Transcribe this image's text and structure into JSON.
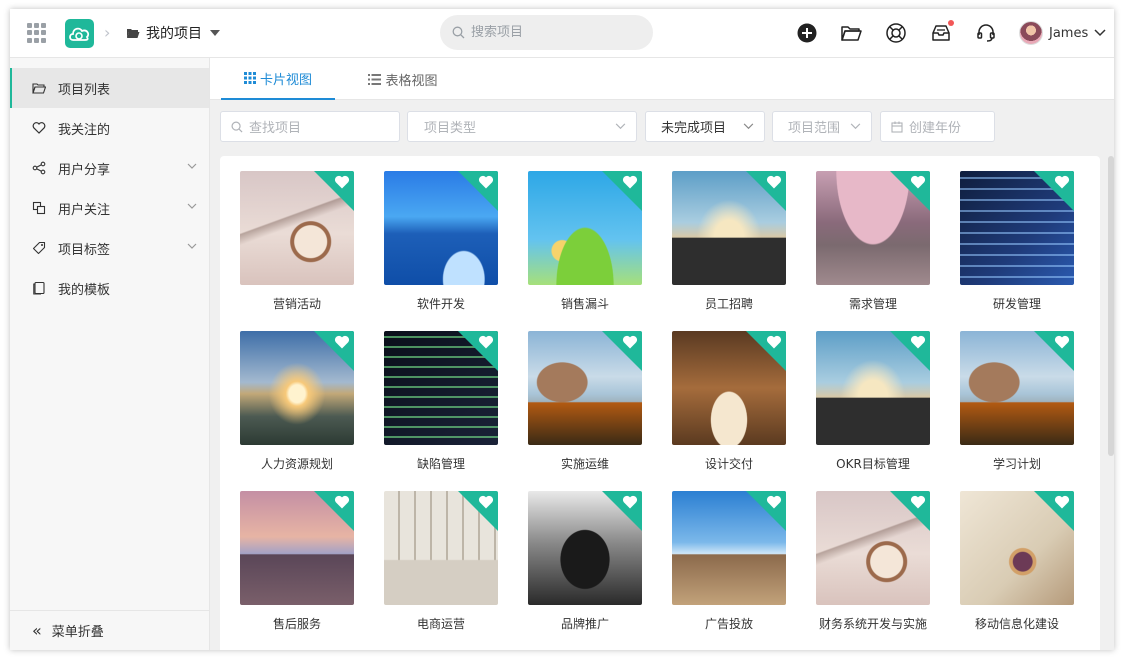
{
  "topbar": {
    "project_menu_label": "我的项目",
    "search_placeholder": "搜索项目",
    "user_name": "James"
  },
  "sidebar": {
    "items": [
      {
        "label": "项目列表",
        "icon": "folder-open-icon",
        "active": true,
        "expandable": false
      },
      {
        "label": "我关注的",
        "icon": "heart-outline-icon",
        "active": false,
        "expandable": false
      },
      {
        "label": "用户分享",
        "icon": "share-icon",
        "active": false,
        "expandable": true
      },
      {
        "label": "用户关注",
        "icon": "copy-icon",
        "active": false,
        "expandable": true
      },
      {
        "label": "项目标签",
        "icon": "tag-icon",
        "active": false,
        "expandable": true
      },
      {
        "label": "我的模板",
        "icon": "template-icon",
        "active": false,
        "expandable": false
      }
    ],
    "collapse_label": "菜单折叠"
  },
  "tabs": [
    {
      "label": "卡片视图",
      "icon": "grid-icon",
      "active": true
    },
    {
      "label": "表格视图",
      "icon": "list-icon",
      "active": false
    }
  ],
  "filters": {
    "search_placeholder": "查找项目",
    "type_placeholder": "项目类型",
    "status_value": "未完成项目",
    "scope_placeholder": "项目范围",
    "year_placeholder": "创建年份"
  },
  "projects": [
    {
      "title": "营销活动",
      "image": "eiffel-clock"
    },
    {
      "title": "软件开发",
      "image": "blue-lake"
    },
    {
      "title": "销售漏斗",
      "image": "cartoon-kids"
    },
    {
      "title": "员工招聘",
      "image": "road-horizon"
    },
    {
      "title": "需求管理",
      "image": "cherry-avenue"
    },
    {
      "title": "研发管理",
      "image": "code-screen"
    },
    {
      "title": "人力资源规划",
      "image": "city-sunset"
    },
    {
      "title": "缺陷管理",
      "image": "code-screen-dark"
    },
    {
      "title": "实施运维",
      "image": "mountain-lake"
    },
    {
      "title": "设计交付",
      "image": "open-book"
    },
    {
      "title": "OKR目标管理",
      "image": "road-horizon"
    },
    {
      "title": "学习计划",
      "image": "mountain-lake"
    },
    {
      "title": "售后服务",
      "image": "pier-sunset"
    },
    {
      "title": "电商运营",
      "image": "living-room"
    },
    {
      "title": "品牌推广",
      "image": "black-car"
    },
    {
      "title": "广告投放",
      "image": "sky-pier"
    },
    {
      "title": "财务系统开发与实施",
      "image": "eiffel-clock"
    },
    {
      "title": "移动信息化建设",
      "image": "pocket-watch"
    }
  ],
  "colors": {
    "accent": "#1fb89a",
    "tab_active": "#1e8bd6"
  }
}
